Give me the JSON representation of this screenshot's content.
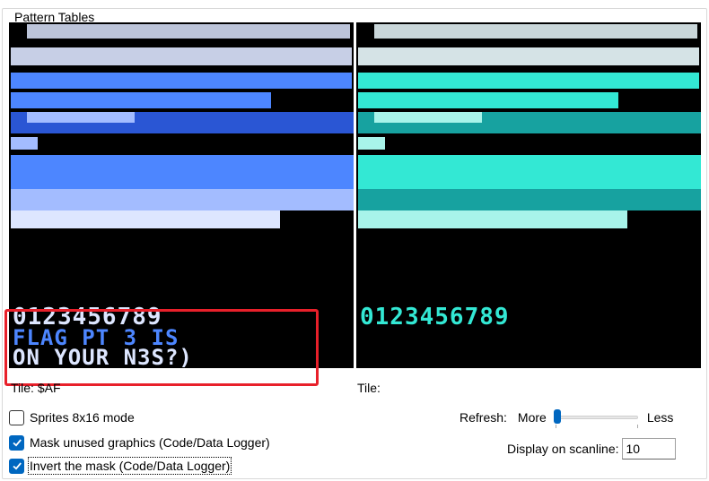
{
  "group": {
    "title": "Pattern Tables"
  },
  "left_view": {
    "digits": "0123456789",
    "message_line1": "FLAG PT 3 IS",
    "message_line2": "ON YOUR N3S?)"
  },
  "right_view": {
    "digits": "0123456789"
  },
  "tile_info": {
    "left": "Tile: $AF",
    "right": "Tile:"
  },
  "options": {
    "sprites_8x16": {
      "label": "Sprites 8x16 mode",
      "checked": false
    },
    "mask_unused": {
      "label": "Mask unused graphics (Code/Data Logger)",
      "checked": true
    },
    "invert_mask": {
      "label": "Invert the mask (Code/Data Logger)",
      "checked": true
    }
  },
  "refresh": {
    "label": "Refresh:",
    "more_label": "More",
    "less_label": "Less",
    "level": 0.0
  },
  "scanline": {
    "label": "Display on scanline:",
    "value": "10"
  },
  "colors": {
    "left_palette": [
      "#000000",
      "#4d86ff",
      "#a3bcff",
      "#dde6ff"
    ],
    "right_palette": [
      "#000000",
      "#17a2a0",
      "#33e8d4",
      "#ecfcff"
    ],
    "accent": "#0067c0",
    "highlight": "#e8202a"
  }
}
